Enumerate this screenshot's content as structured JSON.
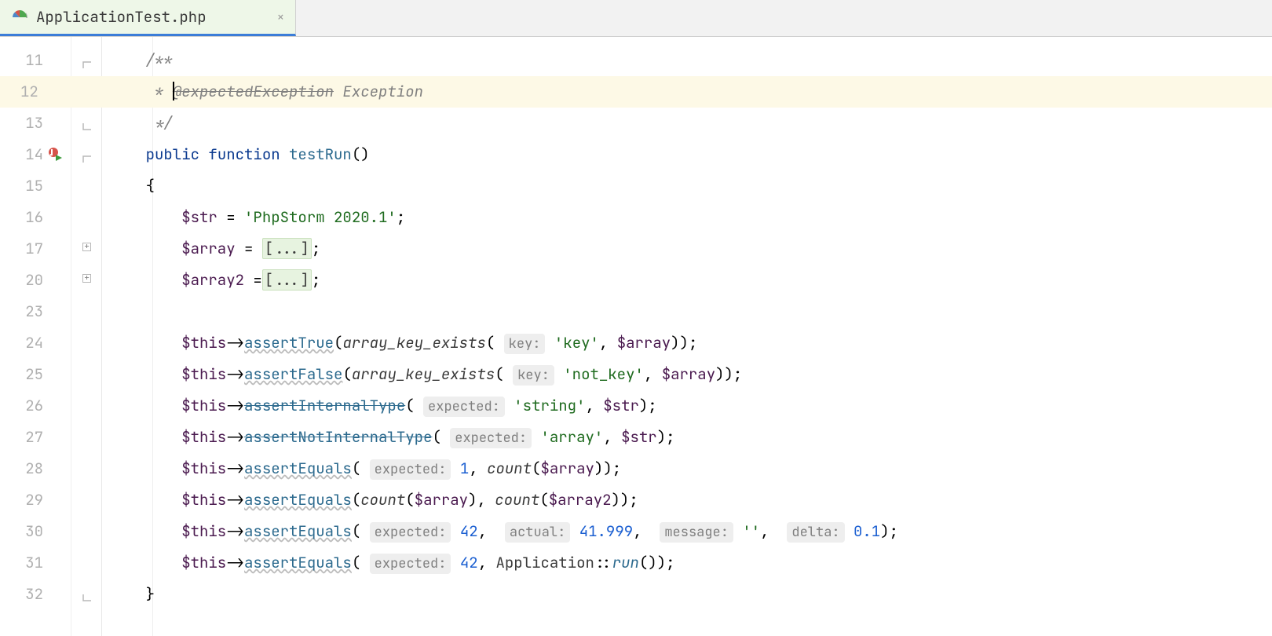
{
  "tab": {
    "filename": "ApplicationTest.php",
    "close_glyph": "×"
  },
  "lines": {
    "n11": "11",
    "n12": "12",
    "n13": "13",
    "n14": "14",
    "n15": "15",
    "n16": "16",
    "n17": "17",
    "n20": "20",
    "n23": "23",
    "n24": "24",
    "n25": "25",
    "n26": "26",
    "n27": "27",
    "n28": "28",
    "n29": "29",
    "n30": "30",
    "n31": "31",
    "n32": "32"
  },
  "code": {
    "c_open": "/**",
    "c_star": " * ",
    "c_tag": "@expectedException",
    "c_excword": " Exception",
    "c_close": " */",
    "kw_public": "public ",
    "kw_function": "function ",
    "fn_name": "testRun",
    "parens": "()",
    "brace_open": "{",
    "brace_close": "}",
    "v_str": "$str",
    "assign": " = ",
    "s_phpstorm": "'PhpStorm 2020.1'",
    "semi": ";",
    "v_array": "$array",
    "v_array2": "$array2",
    "eq_sp": " =",
    "fold_arr": "[...]",
    "v_this": "$this",
    "arrow": "->",
    "m_assertTrue": "assertTrue",
    "m_assertFalse": "assertFalse",
    "m_assertInternalType": "assertInternalType",
    "m_assertNotInternalType": "assertNotInternalType",
    "m_assertEquals": "assertEquals",
    "lp": "(",
    "rp": ")",
    "rpp": "))",
    "ital_ake": "array_key_exists",
    "ital_count": "count",
    "ital_run": "run",
    "hint_key": "key:",
    "hint_expected": "expected:",
    "hint_actual": "actual:",
    "hint_message": "message:",
    "hint_delta": "delta:",
    "s_key": "'key'",
    "s_notkey": "'not_key'",
    "s_string": "'string'",
    "s_array": "'array'",
    "s_empty": "''",
    "comma": ", ",
    "n_1": "1",
    "n_42": "42",
    "n_41999": "41.999",
    "n_01": "0.1",
    "class_app": "Application",
    "dblcolon": "::",
    "sp": " "
  }
}
